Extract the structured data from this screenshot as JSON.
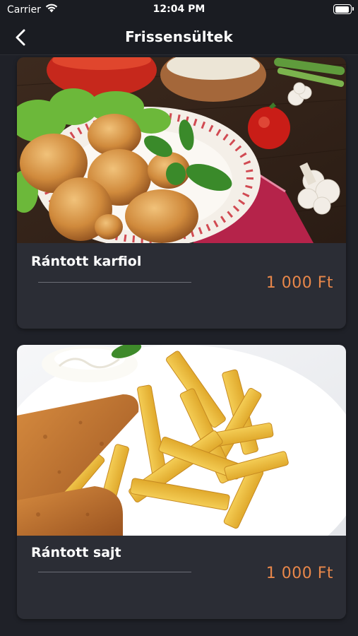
{
  "status_bar": {
    "carrier": "Carrier",
    "time": "12:04 PM"
  },
  "nav": {
    "title": "Frissensültek"
  },
  "items": [
    {
      "name": "Rántott karfiol",
      "price": "1 000 Ft"
    },
    {
      "name": "Rántott sajt",
      "price": "1 000 Ft"
    }
  ],
  "colors": {
    "background": "#1f2128",
    "card": "#2b2d35",
    "price": "#e8874a"
  }
}
